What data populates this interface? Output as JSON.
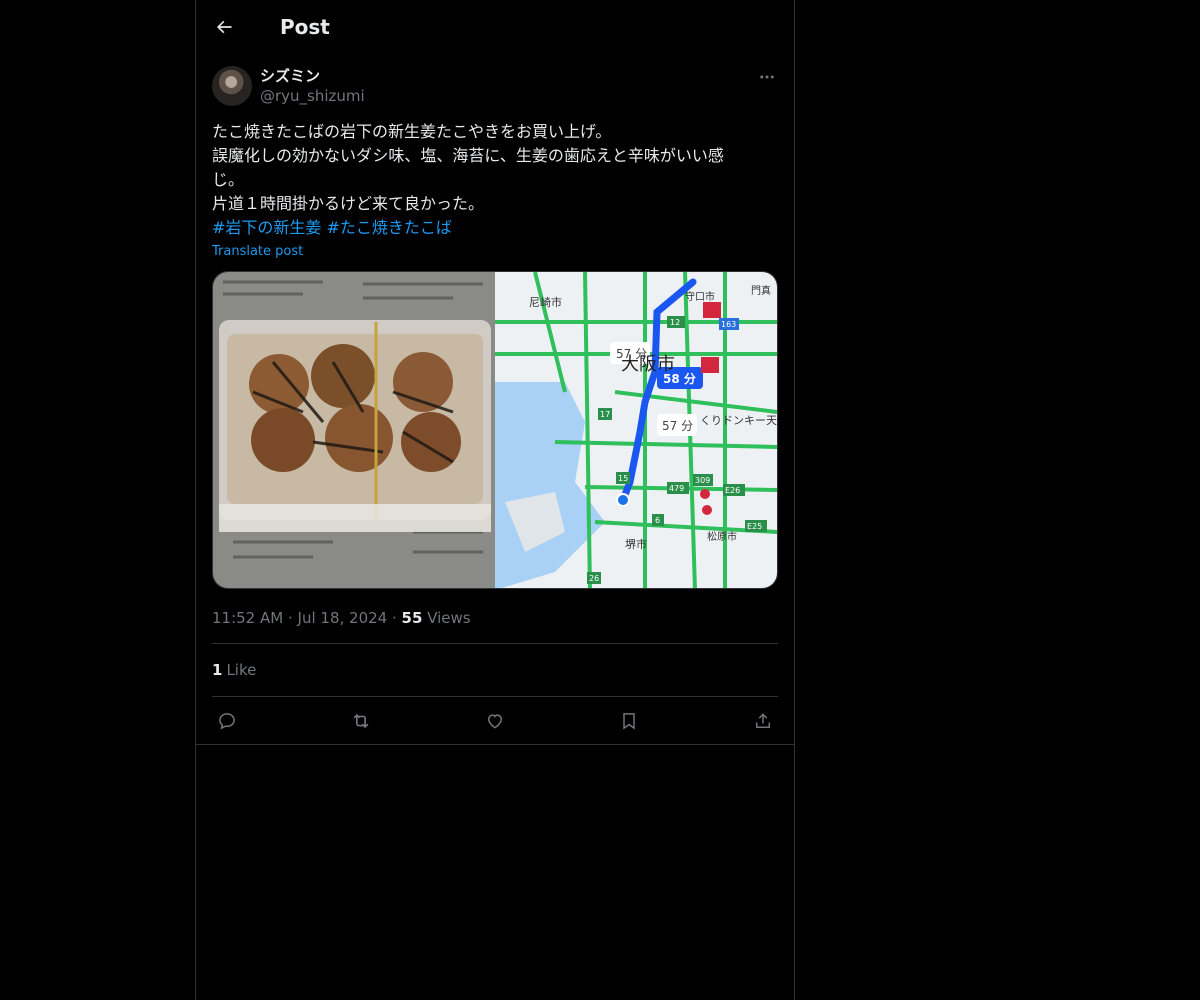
{
  "header": {
    "title": "Post"
  },
  "author": {
    "name": "シズミン",
    "handle": "@ryu_shizumi"
  },
  "post": {
    "lines": [
      "たこ焼きたこばの岩下の新生姜たこやきをお買い上げ。",
      "誤魔化しの効かないダシ味、塩、海苔に、生姜の歯応えと辛味がいい感",
      "じ。",
      "片道１時間掛かるけど来て良かった。"
    ],
    "hashtags": "#岩下の新生姜 #たこ焼きたこば",
    "translate": "Translate post"
  },
  "map": {
    "labels": [
      "尼崎市",
      "守口市",
      "門真",
      "大阪市",
      "57 分",
      "58 分",
      "57 分",
      "くりドンキー天",
      "堺市",
      "松原市"
    ],
    "route_badges": [
      "12",
      "163",
      "17",
      "15",
      "479",
      "E26",
      "E25",
      "6",
      "26",
      "309"
    ]
  },
  "meta": {
    "time": "11:52 AM",
    "date": "Jul 18, 2024",
    "views_count": "55",
    "views_label": "Views"
  },
  "likes": {
    "count": "1",
    "label": "Like"
  },
  "icons": {
    "back": "arrow-left-icon",
    "more": "more-icon",
    "reply": "reply-icon",
    "repost": "repost-icon",
    "like": "heart-icon",
    "bookmark": "bookmark-icon",
    "share": "share-icon"
  },
  "colors": {
    "background": "#000000",
    "text": "#e7e9ea",
    "muted": "#71767b",
    "link": "#1d9bf0",
    "border": "#2f3336"
  }
}
